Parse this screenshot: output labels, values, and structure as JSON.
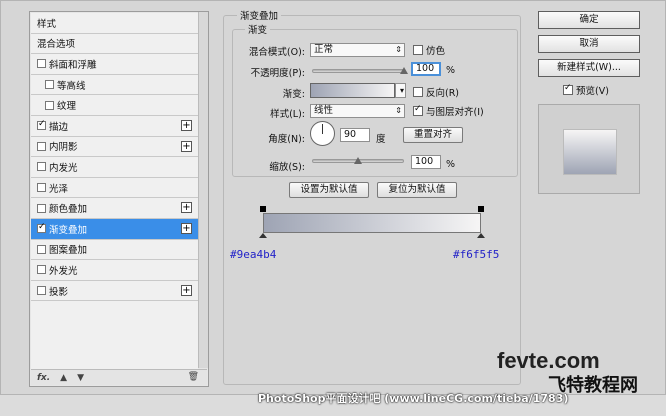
{
  "styles_list": {
    "items": [
      {
        "label": "样式",
        "checkbox": false,
        "checked": false,
        "plus": false,
        "selected": false,
        "indent": false
      },
      {
        "label": "混合选项",
        "checkbox": false,
        "checked": false,
        "plus": false,
        "selected": false,
        "indent": false
      },
      {
        "label": "斜面和浮雕",
        "checkbox": true,
        "checked": false,
        "plus": false,
        "selected": false,
        "indent": false
      },
      {
        "label": "等高线",
        "checkbox": true,
        "checked": false,
        "plus": false,
        "selected": false,
        "indent": true
      },
      {
        "label": "纹理",
        "checkbox": true,
        "checked": false,
        "plus": false,
        "selected": false,
        "indent": true
      },
      {
        "label": "描边",
        "checkbox": true,
        "checked": true,
        "plus": true,
        "selected": false,
        "indent": false
      },
      {
        "label": "内阴影",
        "checkbox": true,
        "checked": false,
        "plus": true,
        "selected": false,
        "indent": false
      },
      {
        "label": "内发光",
        "checkbox": true,
        "checked": false,
        "plus": false,
        "selected": false,
        "indent": false
      },
      {
        "label": "光泽",
        "checkbox": true,
        "checked": false,
        "plus": false,
        "selected": false,
        "indent": false
      },
      {
        "label": "颜色叠加",
        "checkbox": true,
        "checked": false,
        "plus": true,
        "selected": false,
        "indent": false
      },
      {
        "label": "渐变叠加",
        "checkbox": true,
        "checked": true,
        "plus": true,
        "selected": true,
        "indent": false
      },
      {
        "label": "图案叠加",
        "checkbox": true,
        "checked": false,
        "plus": false,
        "selected": false,
        "indent": false
      },
      {
        "label": "外发光",
        "checkbox": true,
        "checked": false,
        "plus": false,
        "selected": false,
        "indent": false
      },
      {
        "label": "投影",
        "checkbox": true,
        "checked": false,
        "plus": true,
        "selected": false,
        "indent": false
      }
    ],
    "footer": {
      "fx": "fx.",
      "trash": "🗑"
    }
  },
  "gradient_overlay": {
    "title": "渐变叠加",
    "subtitle": "渐变",
    "blend_mode_label": "混合模式(O):",
    "blend_mode_value": "正常",
    "dither_label": "仿色",
    "opacity_label": "不透明度(P):",
    "opacity_value": "100",
    "opacity_unit": "%",
    "opacity_level": 1.0,
    "gradient_label": "渐变:",
    "reverse_label": "反向(R)",
    "style_label": "样式(L):",
    "style_value": "线性",
    "align_label": "与图层对齐(I)",
    "angle_label": "角度(N):",
    "angle_value": "90",
    "angle_unit": "度",
    "reset_align_label": "重置对齐",
    "scale_label": "缩放(S):",
    "scale_value": "100",
    "scale_unit": "%",
    "scale_level": 0.5,
    "set_default_label": "设置为默认值",
    "reset_default_label": "复位为默认值"
  },
  "gradient_bar": {
    "start_color": "#9ea4b4",
    "end_color": "#f6f5f5",
    "start_label": "#9ea4b4",
    "end_label": "#f6f5f5"
  },
  "right": {
    "ok": "确定",
    "cancel": "取消",
    "new_style": "新建样式(W)...",
    "preview_label": "预览(V)"
  },
  "watermark": {
    "site": "fevte.com",
    "site_cn": "飞特教程网",
    "caption": "PhotoShop平面设计吧 (www.lineCG.com/tieba/1783)"
  }
}
